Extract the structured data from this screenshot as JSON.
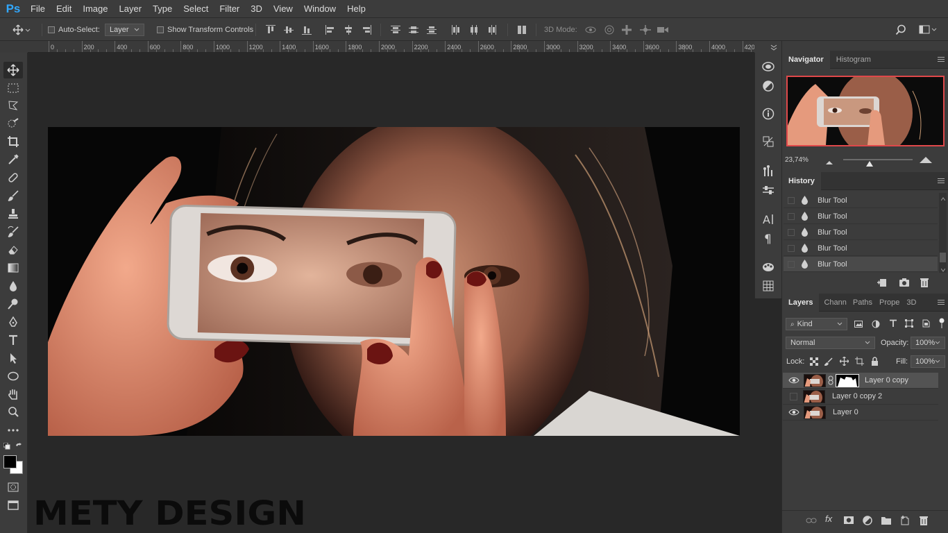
{
  "menubar": {
    "logo": "Ps",
    "items": [
      "File",
      "Edit",
      "Image",
      "Layer",
      "Type",
      "Select",
      "Filter",
      "3D",
      "View",
      "Window",
      "Help"
    ]
  },
  "options": {
    "auto_select_label": "Auto-Select:",
    "auto_select_value": "Layer",
    "show_transform_label": "Show Transform Controls",
    "mode_3d_label": "3D Mode:"
  },
  "ruler": {
    "ticks": [
      "0",
      "200",
      "400",
      "600",
      "800",
      "1000",
      "1200",
      "1400",
      "1600",
      "1800",
      "2000",
      "2200",
      "2400",
      "2600",
      "2800",
      "3000",
      "3200",
      "3400",
      "3600",
      "3800",
      "4000",
      "420"
    ]
  },
  "navigator": {
    "tabs": [
      "Navigator",
      "Histogram"
    ],
    "zoom": "23,74%"
  },
  "history": {
    "tab": "History",
    "items": [
      "Blur Tool",
      "Blur Tool",
      "Blur Tool",
      "Blur Tool",
      "Blur Tool"
    ]
  },
  "layers": {
    "tabs": [
      "Layers",
      "Chann",
      "Paths",
      "Prope",
      "3D"
    ],
    "filter_kind": "Kind",
    "blend_mode": "Normal",
    "opacity_label": "Opacity:",
    "opacity_value": "100%",
    "lock_label": "Lock:",
    "fill_label": "Fill:",
    "fill_value": "100%",
    "items": [
      {
        "name": "Layer 0 copy",
        "visible": true,
        "selected": true
      },
      {
        "name": "Layer 0 copy 2",
        "visible": false,
        "selected": false
      },
      {
        "name": "Layer 0",
        "visible": true,
        "selected": false
      }
    ]
  },
  "watermark": "METY DESIGN",
  "colors": {
    "accent": "#31a8ff",
    "nav_frame": "#e0484a"
  }
}
